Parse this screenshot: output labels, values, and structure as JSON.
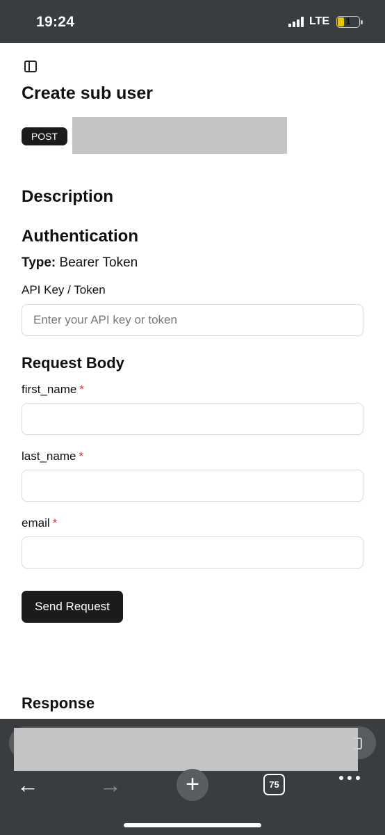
{
  "status_bar": {
    "time": "19:24",
    "network": "LTE",
    "battery_level": "1",
    "signal_icon": "cellular-signal-icon",
    "battery_icon": "battery-icon"
  },
  "header": {
    "sidebar_toggle_icon": "sidebar-toggle-icon",
    "title": "Create sub user",
    "method": "POST"
  },
  "description": {
    "heading": "Description"
  },
  "authentication": {
    "heading": "Authentication",
    "type_label": "Type:",
    "type_value": "Bearer Token",
    "field_label": "API Key / Token",
    "field_placeholder": "Enter your API key or token",
    "field_value": ""
  },
  "request_body": {
    "heading": "Request Body",
    "fields": [
      {
        "label": "first_name",
        "required": "*",
        "value": ""
      },
      {
        "label": "last_name",
        "required": "*",
        "value": ""
      },
      {
        "label": "email",
        "required": "*",
        "value": ""
      }
    ],
    "submit_label": "Send Request"
  },
  "response": {
    "heading": "Response"
  },
  "browser": {
    "back_icon": "arrow-left-icon",
    "forward_icon": "arrow-right-icon",
    "new_tab_icon": "plus-icon",
    "tab_count": "75",
    "more_icon": "more-dots-icon"
  },
  "colors": {
    "chrome_dark": "#3a3d40",
    "button_dark": "#1b1b1b",
    "required_red": "#d93636",
    "redaction_gray": "#c4c4c4"
  }
}
